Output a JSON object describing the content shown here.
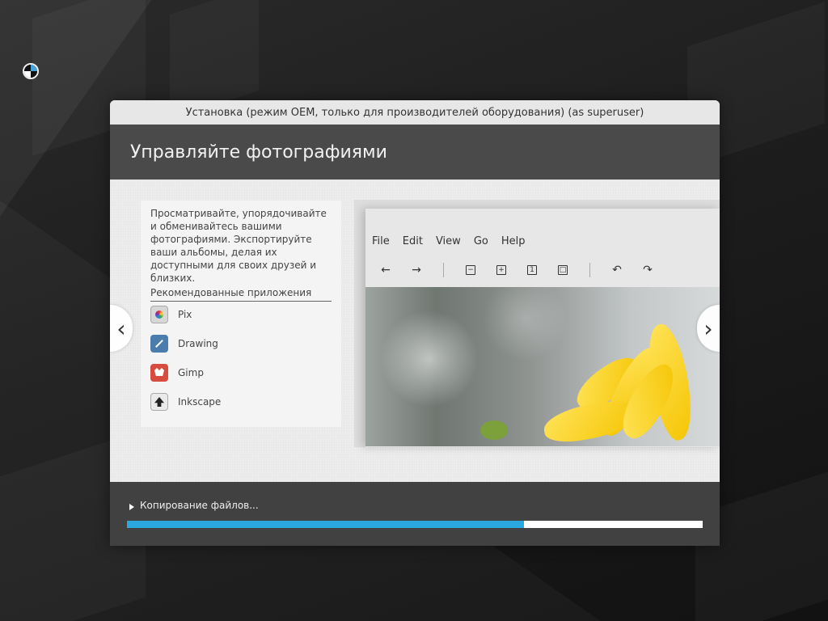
{
  "window": {
    "title": "Установка (режим OEM, только для производителей оборудования) (as superuser)",
    "header": "Управляйте фотографиями"
  },
  "slide": {
    "description": "Просматривайте, упорядочивайте и обменивайтесь вашими фотографиями. Экспортируйте ваши альбомы, делая их доступными для своих друзей и близких.",
    "recommended_title": "Рекомендованные приложения",
    "apps": [
      {
        "name": "Pix",
        "icon": "pix-icon"
      },
      {
        "name": "Drawing",
        "icon": "drawing-icon"
      },
      {
        "name": "Gimp",
        "icon": "gimp-icon"
      },
      {
        "name": "Inkscape",
        "icon": "inkscape-icon"
      }
    ],
    "preview": {
      "menu": [
        "File",
        "Edit",
        "View",
        "Go",
        "Help"
      ],
      "toolbar": [
        "back-icon",
        "forward-icon",
        "zoom-out-icon",
        "zoom-in-icon",
        "actual-size-icon",
        "fit-icon",
        "rotate-left-icon",
        "rotate-right-icon"
      ]
    }
  },
  "footer": {
    "status": "Копирование файлов...",
    "progress": 0.69
  },
  "colors": {
    "header_bg": "#4a4a4a",
    "footer_bg": "#414141",
    "progress": "#2aa7df"
  }
}
